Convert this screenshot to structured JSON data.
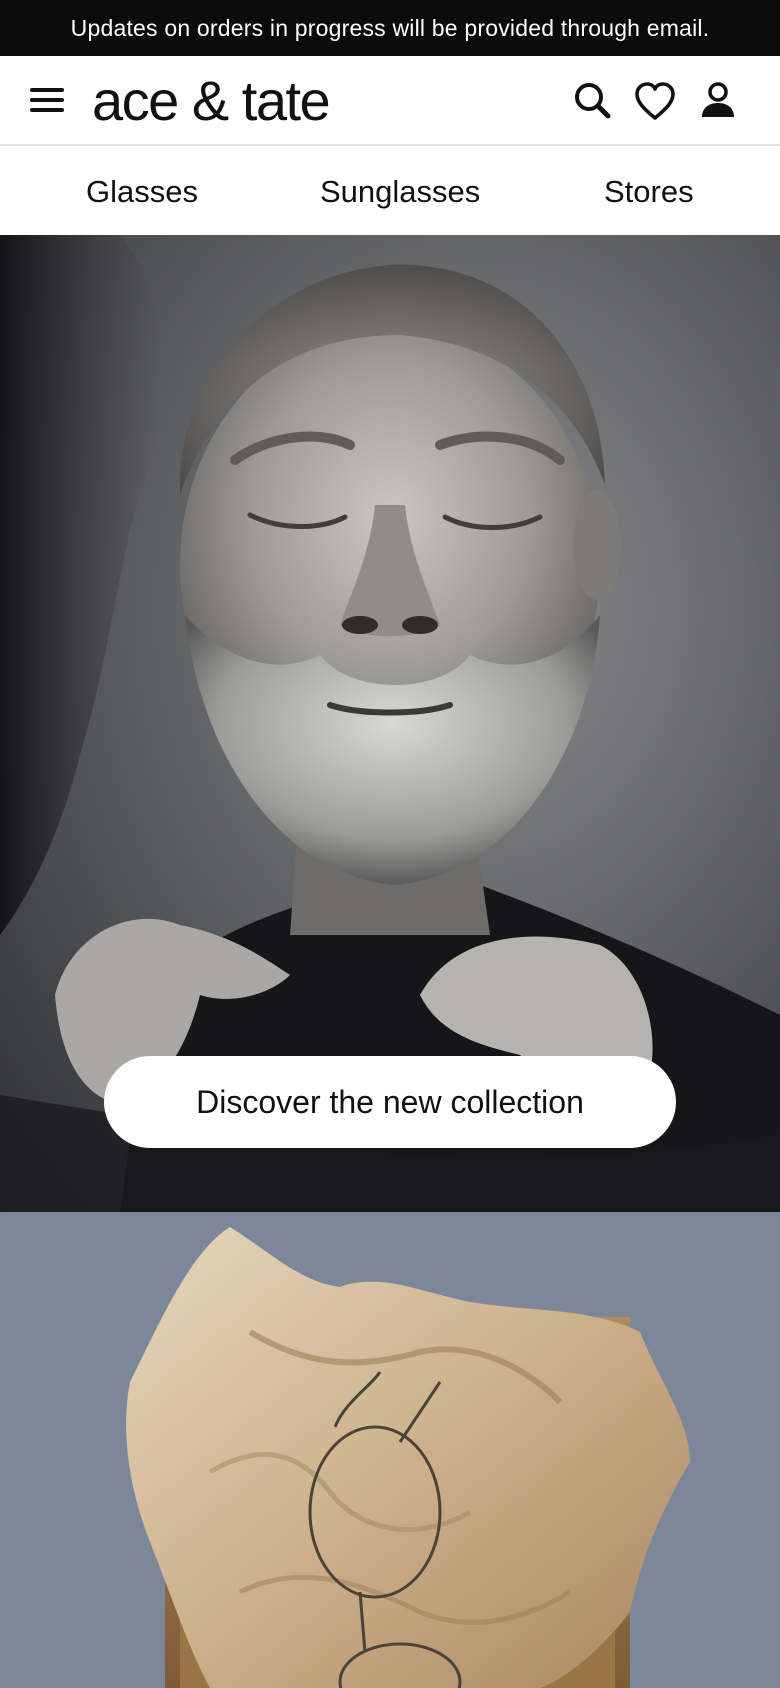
{
  "announcement": {
    "text": "Updates on orders in progress will be provided through email."
  },
  "header": {
    "logo": "ace & tate",
    "icons": {
      "menu": "hamburger-menu-icon",
      "search": "search-icon",
      "wishlist": "heart-icon",
      "account": "user-icon"
    }
  },
  "category_nav": {
    "items": [
      {
        "label": "Glasses"
      },
      {
        "label": "Sunglasses"
      },
      {
        "label": "Stores"
      }
    ]
  },
  "hero": {
    "image": "black-and-white portrait of a bearded man with eyes closed adjusting his collar",
    "cta_label": "Discover the new collection"
  },
  "promo": {
    "image": "wire-frame glasses resting on crumpled paper in a cardboard box"
  },
  "colors": {
    "announcement_bg": "#0b0b0b",
    "header_bg": "#ffffff",
    "text": "#111111",
    "cta_bg": "#ffffff",
    "promo_bg": "#7c8899"
  }
}
